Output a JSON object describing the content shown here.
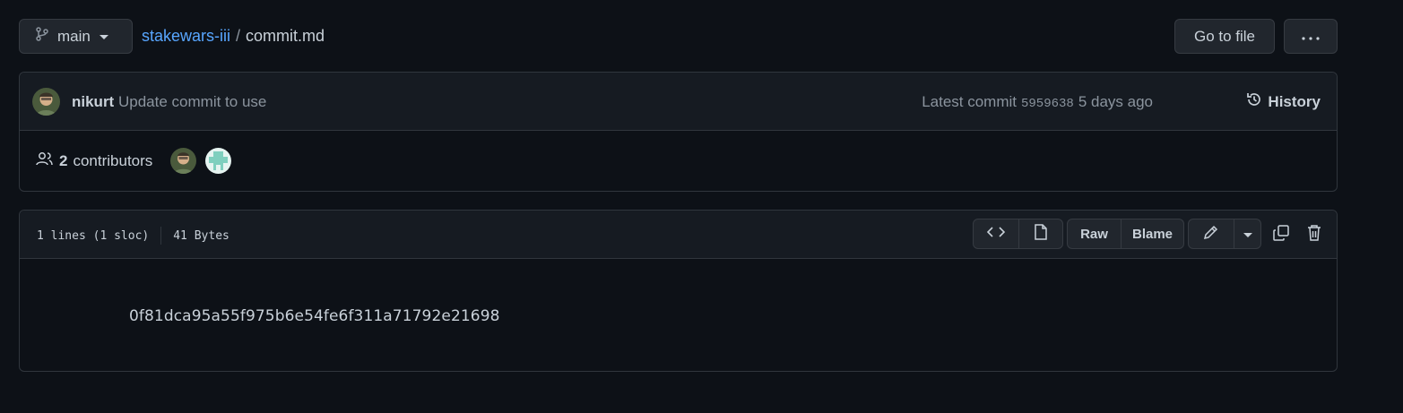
{
  "branch": {
    "label": "main"
  },
  "breadcrumb": {
    "repo": "stakewars-iii",
    "separator": "/",
    "file": "commit.md"
  },
  "header_actions": {
    "goto_file": "Go to file"
  },
  "commit": {
    "author": "nikurt",
    "message": "Update commit to use",
    "latest_label": "Latest commit",
    "sha": "5959638",
    "age": "5 days ago",
    "history_label": "History"
  },
  "contributors": {
    "count": "2",
    "label": "contributors"
  },
  "file": {
    "lines": "1 lines (1 sloc)",
    "size": "41 Bytes",
    "raw_label": "Raw",
    "blame_label": "Blame",
    "content": "0f81dca95a55f975b6e54fe6f311a71792e21698"
  },
  "colors": {
    "background": "#0d1117",
    "link": "#58a6ff",
    "muted": "#8b949e",
    "border": "#30363d"
  }
}
